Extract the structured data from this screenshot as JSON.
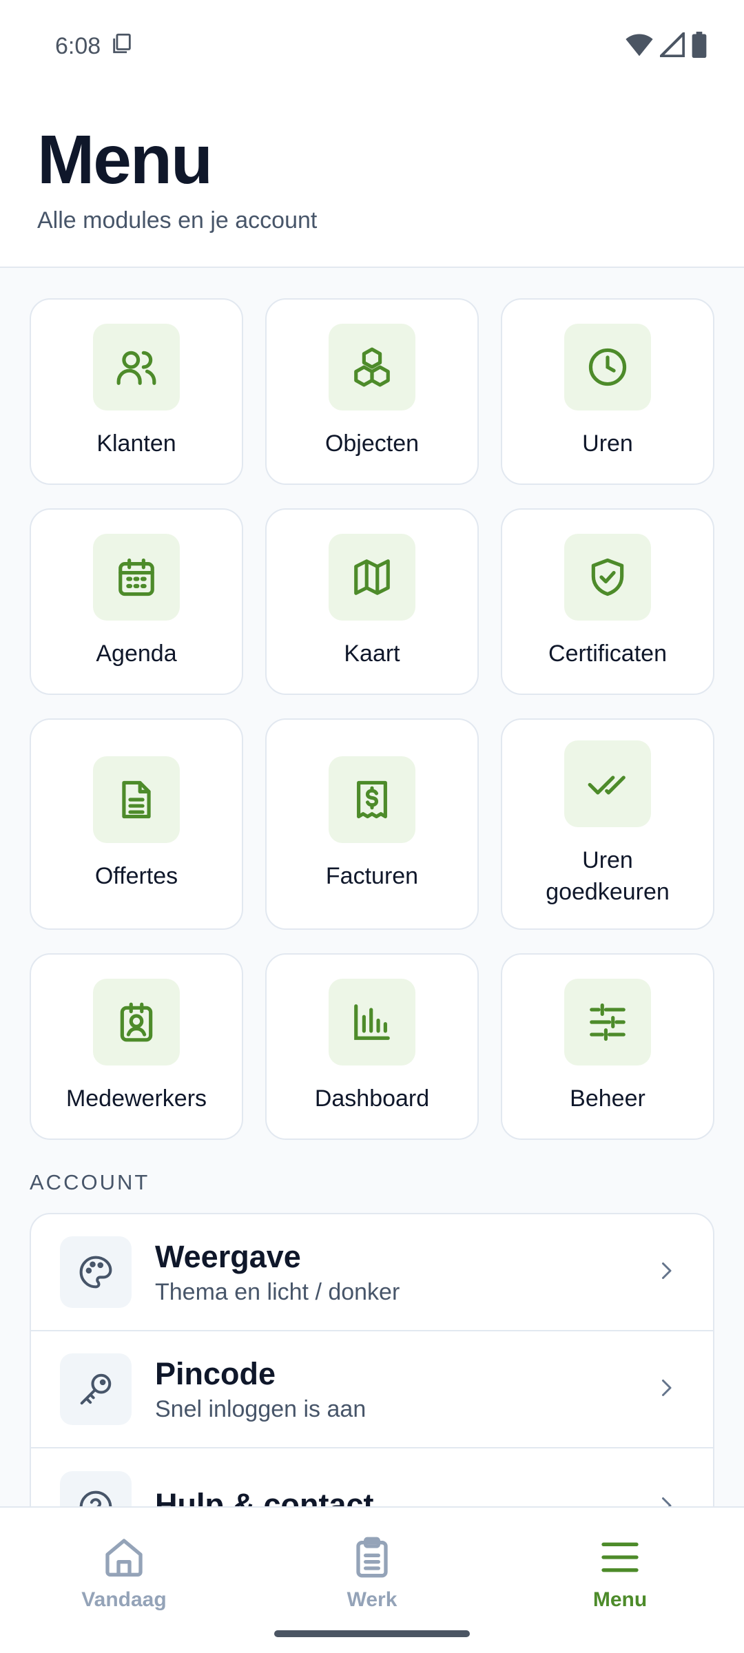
{
  "status_bar": {
    "time": "6:08",
    "icons": [
      "sim-card-icon",
      "wifi-icon",
      "signal-icon",
      "battery-icon"
    ]
  },
  "header": {
    "title": "Menu",
    "subtitle": "Alle modules en je account"
  },
  "modules": [
    {
      "label": "Klanten",
      "icon": "users-icon"
    },
    {
      "label": "Objecten",
      "icon": "boxes-icon"
    },
    {
      "label": "Uren",
      "icon": "clock-icon"
    },
    {
      "label": "Agenda",
      "icon": "calendar-icon"
    },
    {
      "label": "Kaart",
      "icon": "map-icon"
    },
    {
      "label": "Certificaten",
      "icon": "shield-check-icon"
    },
    {
      "label": "Offertes",
      "icon": "document-icon"
    },
    {
      "label": "Facturen",
      "icon": "receipt-icon"
    },
    {
      "label": "Uren goedkeuren",
      "icon": "double-check-icon"
    },
    {
      "label": "Medewerkers",
      "icon": "badge-icon"
    },
    {
      "label": "Dashboard",
      "icon": "bar-chart-icon"
    },
    {
      "label": "Beheer",
      "icon": "sliders-icon"
    }
  ],
  "account": {
    "section_title": "ACCOUNT",
    "items": [
      {
        "title": "Weergave",
        "subtitle": "Thema en licht / donker",
        "icon": "palette-icon"
      },
      {
        "title": "Pincode",
        "subtitle": "Snel inloggen is aan",
        "icon": "key-icon"
      },
      {
        "title": "Hulp & contact",
        "subtitle": "",
        "icon": "help-icon"
      }
    ]
  },
  "bottom_nav": {
    "items": [
      {
        "label": "Vandaag",
        "icon": "home-icon",
        "active": false
      },
      {
        "label": "Werk",
        "icon": "clipboard-icon",
        "active": false
      },
      {
        "label": "Menu",
        "icon": "menu-icon",
        "active": true
      }
    ]
  },
  "colors": {
    "accent": "#4d8b2a",
    "icon_bg": "#edf6e7",
    "muted": "#94a3b8",
    "text": "#0f172a"
  }
}
